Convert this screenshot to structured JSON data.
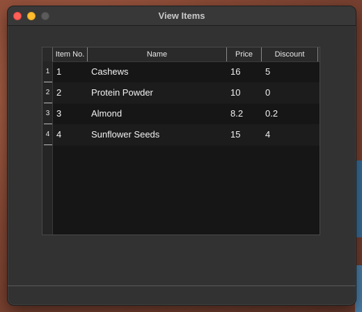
{
  "window": {
    "title": "View Items"
  },
  "table": {
    "columns": [
      "Item No.",
      "Name",
      "Price",
      "Discount"
    ],
    "row_numbers": [
      "1",
      "2",
      "3",
      "4"
    ],
    "rows": [
      {
        "item_no": "1",
        "name": "Cashews",
        "price": "16",
        "discount": "5"
      },
      {
        "item_no": "2",
        "name": "Protein Powder",
        "price": "10",
        "discount": "0"
      },
      {
        "item_no": "3",
        "name": "Almond",
        "price": "8.2",
        "discount": "0.2"
      },
      {
        "item_no": "4",
        "name": "Sunflower Seeds",
        "price": "15",
        "discount": "4"
      }
    ]
  },
  "colors": {
    "close": "#fe5f57",
    "minimize": "#febc2e",
    "zoom_disabled": "#5b5b5b",
    "window_bg": "#323232",
    "table_bg": "#161616"
  }
}
